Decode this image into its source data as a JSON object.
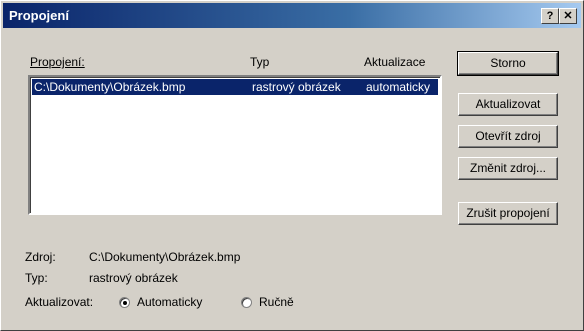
{
  "window": {
    "title": "Propojení",
    "help_label": "?",
    "close_label": "✕"
  },
  "list": {
    "headers": {
      "name": "Propojení:",
      "type": "Typ",
      "update": "Aktualizace"
    },
    "rows": [
      {
        "name": "C:\\Dokumenty\\Obrázek.bmp",
        "type": "rastrový obrázek",
        "update": "automaticky"
      }
    ]
  },
  "buttons": {
    "cancel": "Storno",
    "update": "Aktualizovat",
    "open_source": "Otevřít zdroj",
    "change_source": "Změnit zdroj...",
    "break_link": "Zrušit propojení"
  },
  "details": {
    "source_label": "Zdroj:",
    "source_value": "C:\\Dokumenty\\Obrázek.bmp",
    "type_label": "Typ:",
    "type_value": "rastrový obrázek",
    "update_label": "Aktualizovat:",
    "auto_option": "Automaticky",
    "manual_option": "Ručně",
    "selected": "auto"
  }
}
